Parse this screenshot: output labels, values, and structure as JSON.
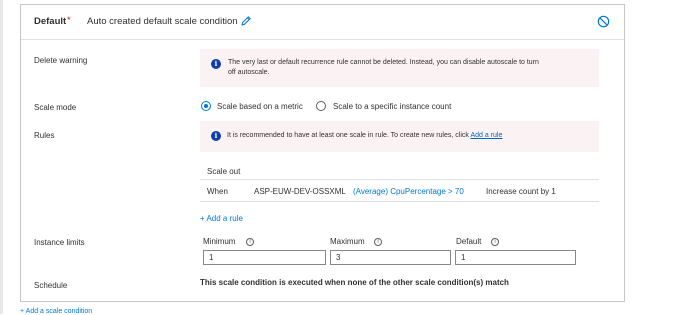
{
  "header": {
    "name": "Default",
    "required_mark": "*",
    "description": "Auto created default scale condition",
    "edit_icon": "pencil-icon",
    "delete_icon": "prohibited-icon"
  },
  "delete_warning": {
    "label": "Delete warning",
    "line1": "The very last or default recurrence rule cannot be deleted. Instead, you can disable autoscale to turn",
    "line2": "off autoscale."
  },
  "scale_mode": {
    "label": "Scale mode",
    "options": [
      "Scale based on a metric",
      "Scale to a specific instance count"
    ],
    "selected": "Scale based on a metric"
  },
  "rules": {
    "label": "Rules",
    "info_text": "It is recommended to have at least one scale in rule. To create new rules, click",
    "info_link": "Add a rule",
    "section_title": "Scale out",
    "row": {
      "when": "When",
      "resource": "ASP-EUW-DEV-OSSXML",
      "metric": "(Average) CpuPercentage > 70",
      "action": "Increase count by 1"
    },
    "add_rule": "+ Add a rule"
  },
  "instance_limits": {
    "label": "Instance limits",
    "minimum_label": "Minimum",
    "maximum_label": "Maximum",
    "default_label": "Default",
    "minimum": "1",
    "maximum": "3",
    "default": "1"
  },
  "schedule": {
    "label": "Schedule",
    "text": "This scale condition is executed when none of the other scale condition(s) match"
  },
  "footer": {
    "add_condition": "+ Add a scale condition"
  },
  "colors": {
    "accent": "#0078d4",
    "info_bg": "#fbf2f3",
    "required": "#a4262c"
  }
}
